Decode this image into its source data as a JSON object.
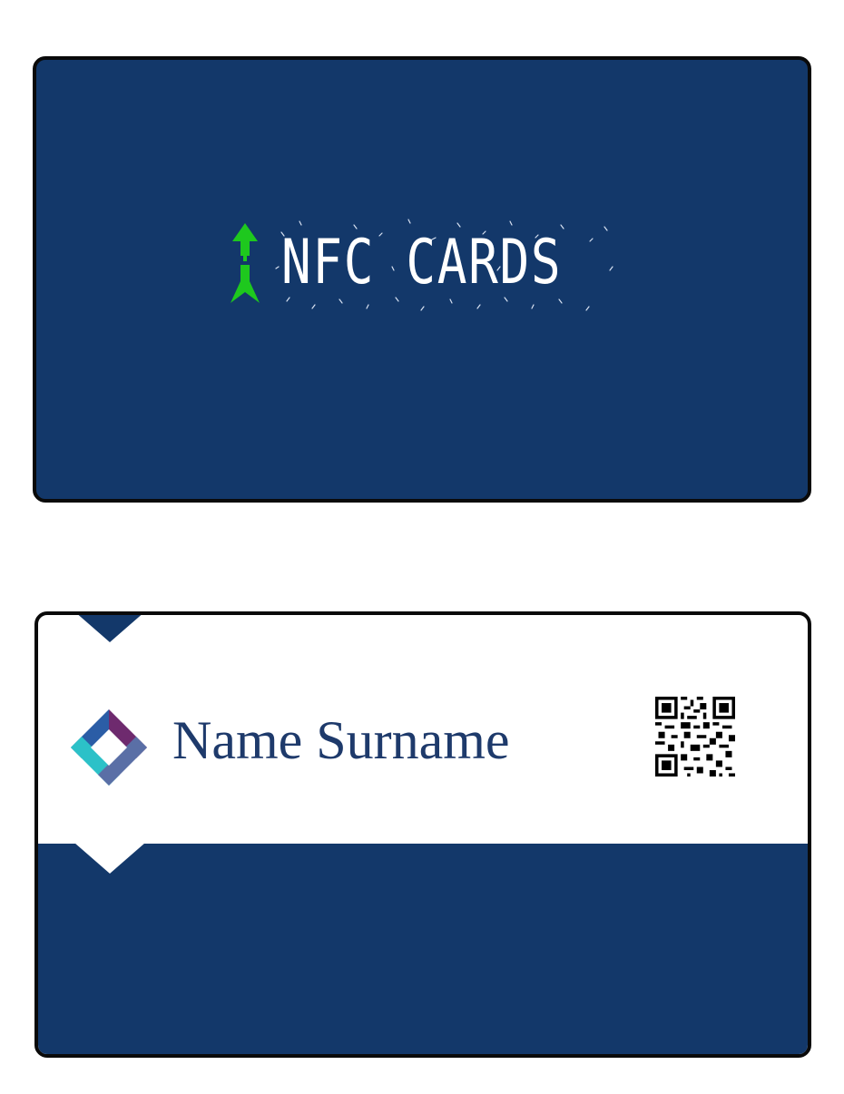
{
  "front_card": {
    "logo_text": "NFC CARDS",
    "background_color": "#13386a",
    "logo_icon": "nfc-arrows-icon",
    "logo_icon_color": "#1ec81e"
  },
  "back_card": {
    "holder_name": "Name Surname",
    "name_color": "#1e3a6b",
    "band_color": "#13386a",
    "brand_icon": "diamond-logo-icon",
    "qr_icon": "qr-code-icon"
  }
}
